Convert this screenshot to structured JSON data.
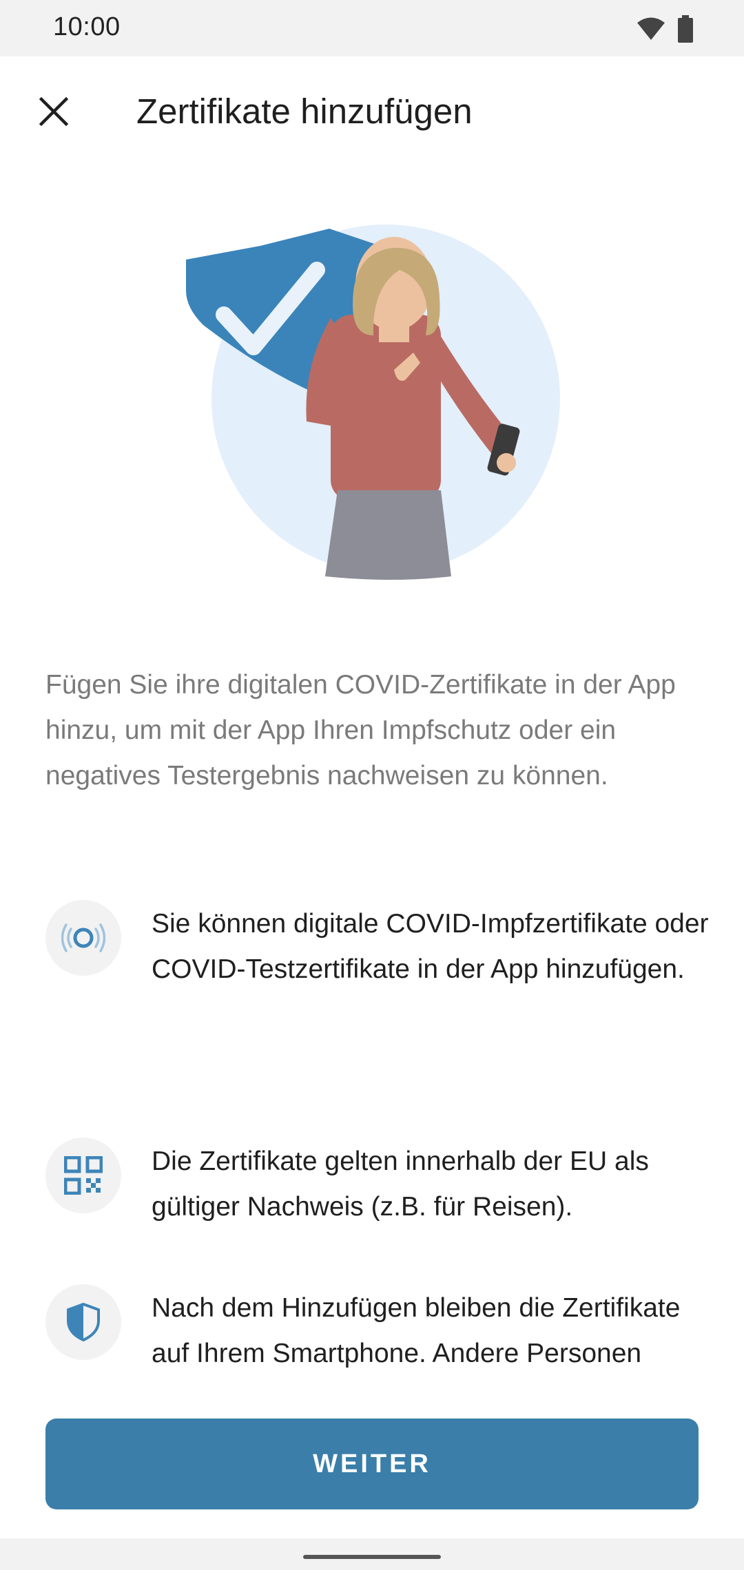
{
  "status_bar": {
    "time": "10:00",
    "icons": [
      "wifi-icon",
      "battery-icon"
    ]
  },
  "app_bar": {
    "close_icon": "close-icon",
    "title": "Zertifikate hinzufügen"
  },
  "intro": "Fügen Sie ihre digitalen COVID-Zertifikate in der App hinzu, um mit der App Ihren Impfschutz oder ein negatives Testergebnis nachweisen zu können.",
  "items": [
    {
      "icon": "scan-icon",
      "text": "Sie können digitale COVID-Impfzertifikate oder COVID-Testzertifikate in der App hinzufügen."
    },
    {
      "icon": "qr-code-icon",
      "text": "Die Zertifikate gelten innerhalb der EU als gültiger Nachweis (z.B. für Reisen)."
    },
    {
      "icon": "shield-icon",
      "text": "Nach dem Hinzufügen bleiben die Zertifikate auf Ihrem Smartphone. Andere Personen können Ihre Daten"
    }
  ],
  "button": {
    "label": "WEITER"
  },
  "colors": {
    "accent": "#3a7ea9",
    "icon_blue": "#3d85b8",
    "title": "#1f1f1f",
    "body_secondary": "#7a7a7a"
  }
}
